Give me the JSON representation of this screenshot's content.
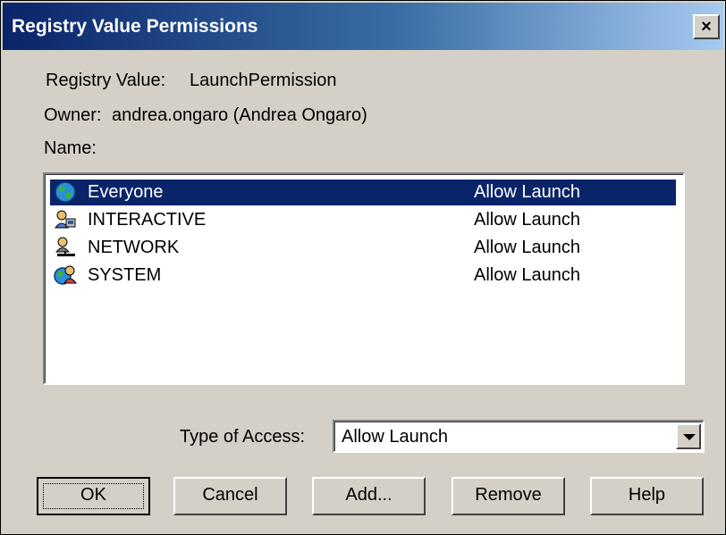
{
  "window": {
    "title": "Registry Value Permissions",
    "close_label": "×"
  },
  "info": {
    "registry_value_label": "Registry Value:",
    "registry_value": "LaunchPermission",
    "owner_label": "Owner:",
    "owner": "andrea.ongaro (Andrea Ongaro)",
    "name_label": "Name:"
  },
  "list": {
    "items": [
      {
        "icon": "globe-icon",
        "name": "Everyone",
        "access": "Allow Launch",
        "selected": true
      },
      {
        "icon": "interactive-users-icon",
        "name": "INTERACTIVE",
        "access": "Allow Launch",
        "selected": false
      },
      {
        "icon": "network-user-icon",
        "name": "NETWORK",
        "access": "Allow Launch",
        "selected": false
      },
      {
        "icon": "system-users-icon",
        "name": "SYSTEM",
        "access": "Allow Launch",
        "selected": false
      }
    ]
  },
  "type_of_access": {
    "label": "Type of Access:",
    "value": "Allow Launch"
  },
  "buttons": {
    "ok": "OK",
    "cancel": "Cancel",
    "add": "Add...",
    "remove": "Remove",
    "help": "Help"
  },
  "colors": {
    "title_start": "#0a246a",
    "title_end": "#a6caf0",
    "selection": "#0a246a",
    "face": "#d4d0c8"
  }
}
